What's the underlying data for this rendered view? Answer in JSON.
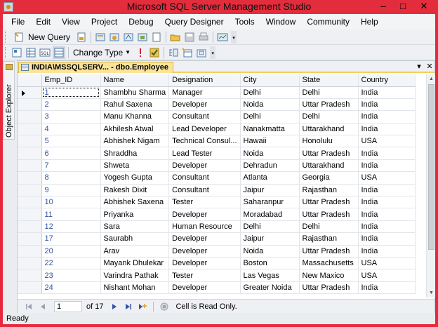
{
  "window": {
    "title": "Microsoft SQL Server Management Studio",
    "minimize": "–",
    "maximize": "□",
    "close": "✕"
  },
  "menu": [
    "File",
    "Edit",
    "View",
    "Project",
    "Debug",
    "Query Designer",
    "Tools",
    "Window",
    "Community",
    "Help"
  ],
  "toolbar": {
    "new_query": "New Query",
    "change_type": "Change Type"
  },
  "side_panel": {
    "label": "Object Explorer"
  },
  "document": {
    "tab_title": "INDIA\\MSSQLSERV... - dbo.Employee",
    "pin": "▾",
    "close": "✕"
  },
  "grid": {
    "columns": [
      "Emp_ID",
      "Name",
      "Designation",
      "City",
      "State",
      "Country"
    ],
    "rows": [
      [
        "1",
        "Shambhu Sharma",
        "Manager",
        "Delhi",
        "Delhi",
        "India"
      ],
      [
        "2",
        "Rahul Saxena",
        "Developer",
        "Noida",
        "Uttar Pradesh",
        "India"
      ],
      [
        "3",
        "Manu Khanna",
        "Consultant",
        "Delhi",
        "Delhi",
        "India"
      ],
      [
        "4",
        "Akhilesh Atwal",
        "Lead Developer",
        "Nanakmatta",
        "Uttarakhand",
        "India"
      ],
      [
        "5",
        "Abhishek Nigam",
        "Technical Consul...",
        "Hawaii",
        "Honolulu",
        "USA"
      ],
      [
        "6",
        "Shraddha",
        "Lead Tester",
        "Noida",
        "Uttar Pradesh",
        "India"
      ],
      [
        "7",
        "Shweta",
        "Developer",
        "Dehradun",
        "Uttarakhand",
        "India"
      ],
      [
        "8",
        "Yogesh Gupta",
        "Consultant",
        "Atlanta",
        "Georgia",
        "USA"
      ],
      [
        "9",
        "Rakesh Dixit",
        "Consultant",
        "Jaipur",
        "Rajasthan",
        "India"
      ],
      [
        "10",
        "Abhishek Saxena",
        "Tester",
        "Saharanpur",
        "Uttar Pradesh",
        "India"
      ],
      [
        "11",
        "Priyanka",
        "Developer",
        "Moradabad",
        "Uttar Pradesh",
        "India"
      ],
      [
        "12",
        "Sara",
        "Human Resource",
        "Delhi",
        "Delhi",
        "India"
      ],
      [
        "17",
        "Saurabh",
        "Developer",
        "Jaipur",
        "Rajasthan",
        "India"
      ],
      [
        "20",
        "Arav",
        "Developer",
        "Noida",
        "Uttar Pradesh",
        "India"
      ],
      [
        "22",
        "Mayank Dhulekar",
        "Developer",
        "Boston",
        "Massachusetts",
        "USA"
      ],
      [
        "23",
        "Varindra Pathak",
        "Tester",
        "Las Vegas",
        "New Maxico",
        "USA"
      ],
      [
        "24",
        "Nishant Mohan",
        "Developer",
        "Greater Noida",
        "Uttar Pradesh",
        "India"
      ]
    ]
  },
  "navigator": {
    "current": "1",
    "of_label": "of 17",
    "status": "Cell is Read Only."
  },
  "statusbar": {
    "text": "Ready"
  }
}
